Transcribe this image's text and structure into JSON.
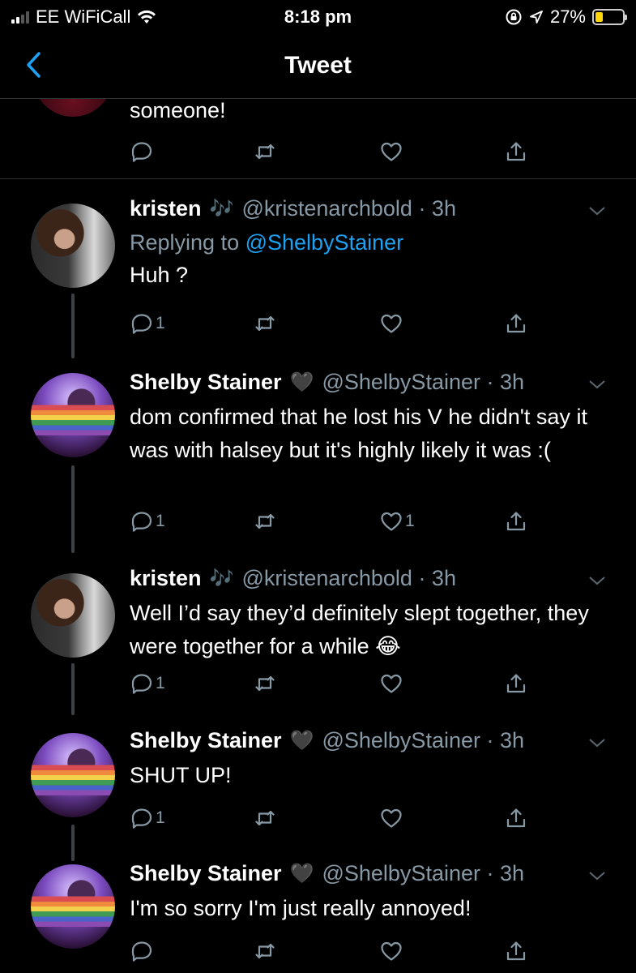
{
  "status_bar": {
    "carrier": "EE WiFiCall",
    "time": "8:18 pm",
    "battery_pct_label": "27%",
    "battery_level": 0.27,
    "battery_color": "#ffd60a"
  },
  "nav": {
    "title": "Tweet",
    "back_icon": "chevron-left-icon"
  },
  "top_tweet": {
    "text": "someone!"
  },
  "tweets": [
    {
      "name": "kristen",
      "emoji": "🎶",
      "handle": "@kristenarchbold · 3h",
      "replying_prefix": "Replying to ",
      "replying_handle": "@ShelbyStainer",
      "text": "Huh ?",
      "reply_count": "1",
      "like_count": ""
    },
    {
      "name": "Shelby Stainer",
      "emoji": "🖤",
      "handle": "@ShelbyStainer · 3h",
      "text": "dom confirmed that he lost his V he didn't say it was with halsey but it's highly likely it was :(",
      "reply_count": "1",
      "like_count": "1"
    },
    {
      "name": "kristen",
      "emoji": "🎶",
      "handle": "@kristenarchbold · 3h",
      "text": "Well I’d say they’d definitely slept together, they were together for a while 😂",
      "reply_count": "1",
      "like_count": ""
    },
    {
      "name": "Shelby Stainer",
      "emoji": "🖤",
      "handle": "@ShelbyStainer · 3h",
      "text": "SHUT UP!",
      "reply_count": "1",
      "like_count": ""
    },
    {
      "name": "Shelby Stainer",
      "emoji": "🖤",
      "handle": "@ShelbyStainer · 3h",
      "text": "I'm so sorry I'm just really annoyed!",
      "reply_count": "",
      "like_count": ""
    }
  ],
  "colors": {
    "background": "#000000",
    "secondary_text": "#8899a6",
    "link": "#1da1f2",
    "divider": "#2f3336"
  }
}
